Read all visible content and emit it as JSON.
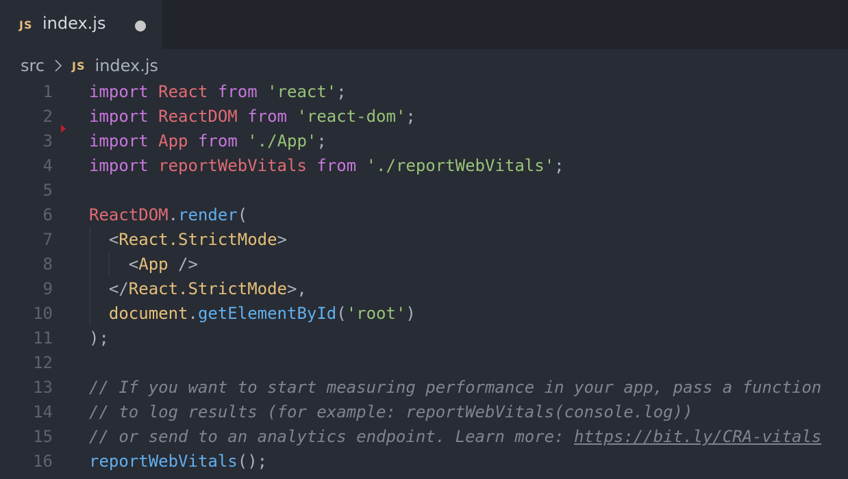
{
  "tab": {
    "badge": "JS",
    "filename": "index.js",
    "unsaved": true
  },
  "breadcrumb": {
    "folder": "src",
    "badge": "JS",
    "file": "index.js"
  },
  "editor": {
    "lines": [
      {
        "n": "1",
        "tokens": [
          [
            "kw",
            "import"
          ],
          [
            "punc",
            " "
          ],
          [
            "var",
            "React"
          ],
          [
            "punc",
            " "
          ],
          [
            "kw",
            "from"
          ],
          [
            "punc",
            " "
          ],
          [
            "str",
            "'react'"
          ],
          [
            "punc",
            ";"
          ]
        ]
      },
      {
        "n": "2",
        "tokens": [
          [
            "kw",
            "import"
          ],
          [
            "punc",
            " "
          ],
          [
            "var",
            "ReactDOM"
          ],
          [
            "punc",
            " "
          ],
          [
            "kw",
            "from"
          ],
          [
            "punc",
            " "
          ],
          [
            "str",
            "'react-dom'"
          ],
          [
            "punc",
            ";"
          ]
        ]
      },
      {
        "n": "3",
        "tokens": [
          [
            "kw",
            "import"
          ],
          [
            "punc",
            " "
          ],
          [
            "var",
            "App"
          ],
          [
            "punc",
            " "
          ],
          [
            "kw",
            "from"
          ],
          [
            "punc",
            " "
          ],
          [
            "str",
            "'./App'"
          ],
          [
            "punc",
            ";"
          ]
        ]
      },
      {
        "n": "4",
        "tokens": [
          [
            "kw",
            "import"
          ],
          [
            "punc",
            " "
          ],
          [
            "var",
            "reportWebVitals"
          ],
          [
            "punc",
            " "
          ],
          [
            "kw",
            "from"
          ],
          [
            "punc",
            " "
          ],
          [
            "str",
            "'./reportWebVitals'"
          ],
          [
            "punc",
            ";"
          ]
        ]
      },
      {
        "n": "5",
        "tokens": []
      },
      {
        "n": "6",
        "tokens": [
          [
            "var",
            "ReactDOM"
          ],
          [
            "punc",
            "."
          ],
          [
            "fn",
            "render"
          ],
          [
            "punc",
            "("
          ]
        ]
      },
      {
        "n": "7",
        "tokens": [
          [
            "punc",
            "  <"
          ],
          [
            "tag",
            "React.StrictMode"
          ],
          [
            "punc",
            ">"
          ]
        ]
      },
      {
        "n": "8",
        "tokens": [
          [
            "punc",
            "    <"
          ],
          [
            "tag",
            "App"
          ],
          [
            "punc",
            " />"
          ]
        ]
      },
      {
        "n": "9",
        "tokens": [
          [
            "punc",
            "  </"
          ],
          [
            "tag",
            "React.StrictMode"
          ],
          [
            "punc",
            ">,"
          ]
        ]
      },
      {
        "n": "10",
        "tokens": [
          [
            "punc",
            "  "
          ],
          [
            "tag",
            "document"
          ],
          [
            "punc",
            "."
          ],
          [
            "fn",
            "getElementById"
          ],
          [
            "punc",
            "("
          ],
          [
            "str",
            "'root'"
          ],
          [
            "punc",
            ")"
          ]
        ]
      },
      {
        "n": "11",
        "tokens": [
          [
            "punc",
            ");"
          ]
        ]
      },
      {
        "n": "12",
        "tokens": []
      },
      {
        "n": "13",
        "tokens": [
          [
            "cmt",
            "// If you want to start measuring performance in your app, pass a function"
          ]
        ]
      },
      {
        "n": "14",
        "tokens": [
          [
            "cmt",
            "// to log results (for example: reportWebVitals(console.log))"
          ]
        ]
      },
      {
        "n": "15",
        "tokens": [
          [
            "cmt",
            "// or send to an analytics endpoint. Learn more: "
          ],
          [
            "cmt link",
            "https://bit.ly/CRA-vitals"
          ]
        ]
      },
      {
        "n": "16",
        "tokens": [
          [
            "fn",
            "reportWebVitals"
          ],
          [
            "punc",
            "();"
          ]
        ]
      }
    ]
  },
  "colors": {
    "background": "#282c34",
    "tabbar": "#21252b",
    "keyword": "#c678dd",
    "variable": "#e06c75",
    "string": "#98c379",
    "function": "#61afef",
    "tag": "#e5c07b",
    "comment": "#7f848e",
    "line_number": "#5c6370"
  }
}
